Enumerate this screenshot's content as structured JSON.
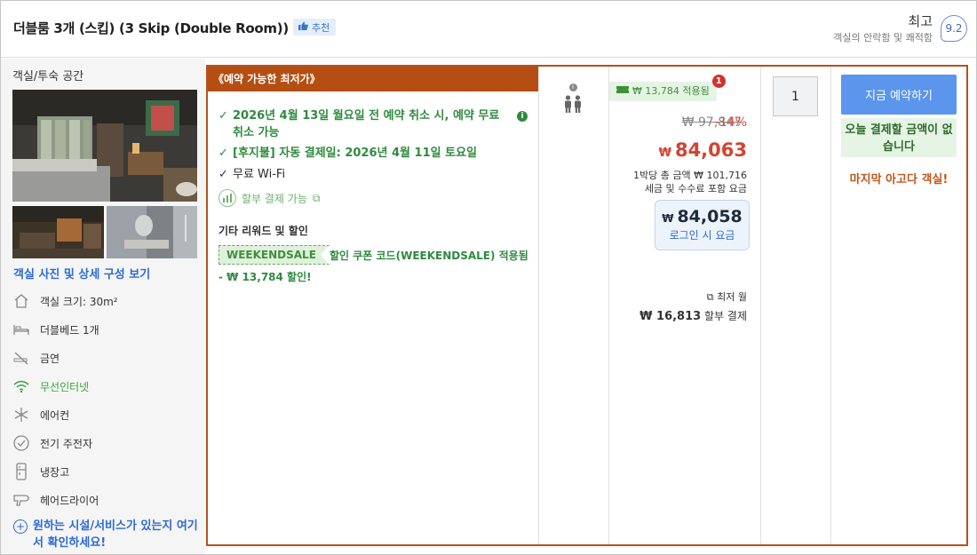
{
  "header": {
    "room_title": "더블룸 3개 (스킵) (3 Skip (Double Room))",
    "recommend_label": "추천",
    "rating_word": "최고",
    "rating_sub": "객실의 안락함 및 쾌적함",
    "rating_score": "9.2"
  },
  "sidebar": {
    "heading": "객실/투숙 공간",
    "photo_link": "객실 사진 및 상세 구성 보기",
    "features": [
      {
        "label": "객실 크기: 30m²",
        "icon": "house-icon"
      },
      {
        "label": "더블베드 1개",
        "icon": "bed-icon"
      },
      {
        "label": "금연",
        "icon": "no-smoking-icon"
      },
      {
        "label": "무선인터넷",
        "icon": "wifi-icon"
      },
      {
        "label": "에어컨",
        "icon": "snowflake-icon"
      },
      {
        "label": "전기 주전자",
        "icon": "kettle-icon"
      },
      {
        "label": "냉장고",
        "icon": "fridge-icon"
      },
      {
        "label": "헤어드라이어",
        "icon": "hairdryer-icon"
      }
    ],
    "more_link": "원하는 시설/서비스가 있는지 여기서 확인하세요!"
  },
  "deal": {
    "banner": "《예약 가능한 최저가》",
    "conditions": [
      "2026년 4월 13일 월요일 전 예약 취소 시, 예약 무료 취소 가능",
      "[후지불] 자동 결제일: 2026년 4월 11일 토요일",
      "무료 Wi-Fi"
    ],
    "installment": "할부 결제 가능",
    "other_title": "기타 리워드 및 할인",
    "coupon_code": "WEEKENDSALE",
    "coupon_text": "할인 쿠폰 코드(WEEKENDSALE) 적용됨",
    "coupon_save": "- ₩ 13,784 할인!"
  },
  "pricing": {
    "applied_pill": "₩ 13,784 적용됨",
    "applied_badge": "1",
    "original_price": "₩ 97,847",
    "discount": "-14%",
    "currency": "₩",
    "final_price": "84,063",
    "per_night": "1박당 총 금액 ₩ 101,716",
    "tax_note": "세금 및 수수료 포함 요금",
    "login_price": "84,058",
    "login_label": "로그인 시 요금",
    "monthly_label": "최저 월",
    "monthly_amount": "₩ 16,813",
    "monthly_suffix": "할부 결제"
  },
  "booking": {
    "quantity": "1",
    "book_button": "지금 예약하기",
    "no_payment": "오늘 결제할 금액이 없습니다",
    "last_room": "마지막 아고다 객실!"
  },
  "colors": {
    "accent_orange": "#b54e12",
    "price_red": "#d4432e",
    "button_blue": "#5b95ec",
    "success_green": "#2e8b3e"
  }
}
